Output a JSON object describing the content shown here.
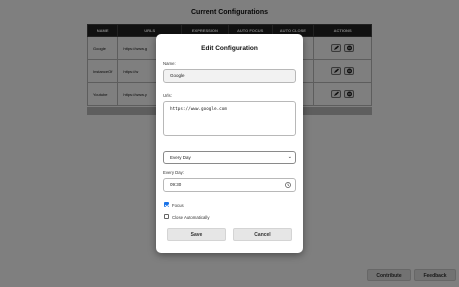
{
  "page": {
    "title": "Current Configurations",
    "table": {
      "headers": [
        "NAME",
        "URLS",
        "EXPRESSION",
        "AUTO FOCUS",
        "AUTO CLOSE",
        "ACTIONS"
      ],
      "rows": [
        {
          "name": "Google",
          "url": "https://www.g"
        },
        {
          "name": "InstanceOf",
          "url": "https://w"
        },
        {
          "name": "Youtube",
          "url": "https://www.y"
        }
      ]
    },
    "buttons": {
      "contribute": "Contribute",
      "feedback": "Feedback"
    }
  },
  "modal": {
    "title": "Edit Configuration",
    "name_label": "Name:",
    "name_value": "Google",
    "urls_label": "Urls:",
    "urls_value": "https://www.google.com",
    "frequency_value": "Every Day",
    "every_day_label": "Every Day:",
    "time_value": "09:30",
    "focus_label": "Focus",
    "focus_checked": true,
    "close_label": "Close Automatically",
    "close_checked": false,
    "save_label": "Save",
    "cancel_label": "Cancel"
  },
  "colors": {
    "overlay": "#000000",
    "checkbox_accent": "#1a73e8",
    "header_bg": "#222222"
  },
  "icons": [
    "pencil-icon",
    "remove-icon",
    "clock-icon",
    "chevron-down-icon"
  ]
}
